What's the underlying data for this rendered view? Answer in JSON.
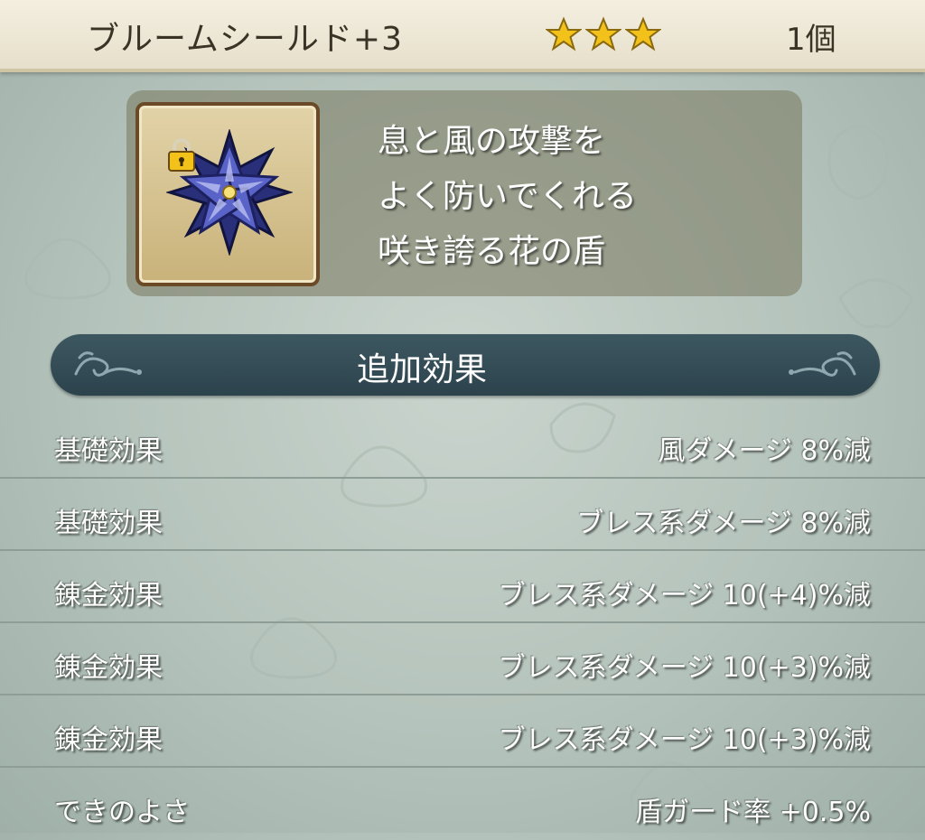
{
  "header": {
    "item_name": "ブルームシールド+3",
    "star_count": 3,
    "quantity": "1個"
  },
  "description": {
    "icon": "blue-flower-shield-icon",
    "locked": true,
    "lines": [
      "息と風の攻撃を",
      "よく防いでくれる",
      "咲き誇る花の盾"
    ]
  },
  "section": {
    "title": "追加効果"
  },
  "effects": [
    {
      "label": "基礎効果",
      "value": "風ダメージ 8%減"
    },
    {
      "label": "基礎効果",
      "value": "ブレス系ダメージ 8%減"
    },
    {
      "label": "錬金効果",
      "value": "ブレス系ダメージ 10(+4)%減"
    },
    {
      "label": "錬金効果",
      "value": "ブレス系ダメージ 10(+3)%減"
    },
    {
      "label": "錬金効果",
      "value": "ブレス系ダメージ 10(+3)%減"
    },
    {
      "label": "できのよさ",
      "value": "盾ガード率 +0.5%"
    }
  ],
  "colors": {
    "background": "#b4c3bb",
    "header": "#f4efe0",
    "banner": "#2c434c",
    "star": "#f2c21a"
  }
}
